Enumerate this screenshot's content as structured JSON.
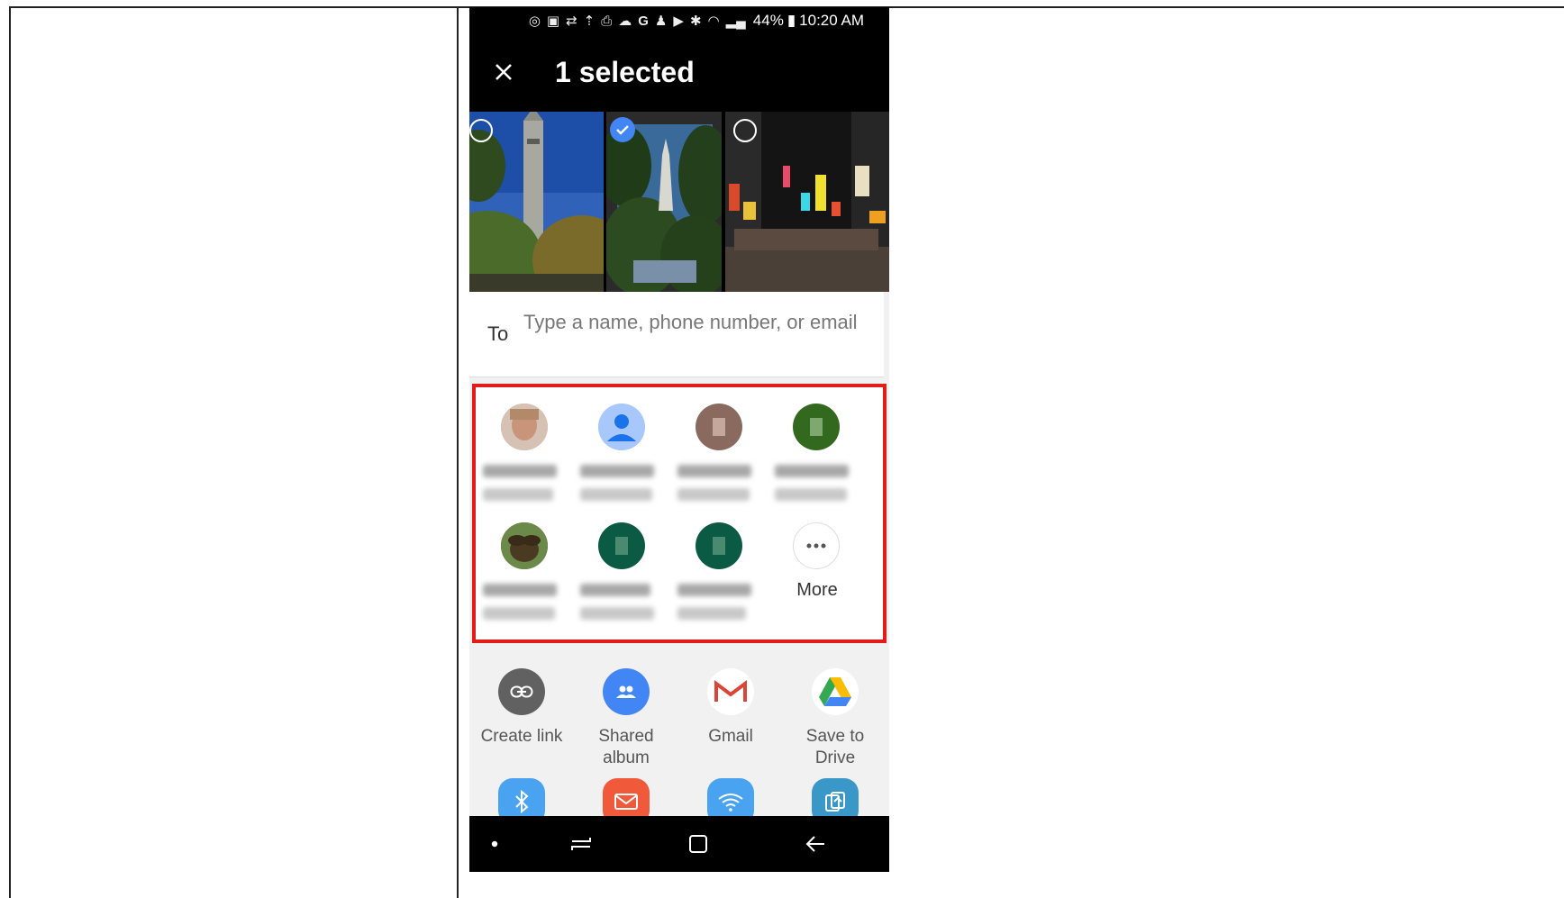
{
  "status_bar": {
    "battery": "44%",
    "time": "10:20 AM"
  },
  "app_bar": {
    "title": "1 selected",
    "close_icon": "close-icon"
  },
  "photos": [
    {
      "name": "tower-photo",
      "selected": false
    },
    {
      "name": "building-photo",
      "selected": true
    },
    {
      "name": "night-street-photo",
      "selected": false
    }
  ],
  "recipient": {
    "label": "To",
    "placeholder": "Type a name, phone number, or email"
  },
  "contacts": {
    "more_label": "More"
  },
  "share_apps": [
    {
      "label": "Create link",
      "icon": "link-icon",
      "color": "#616161"
    },
    {
      "label": "Shared album",
      "icon": "shared-album-icon",
      "color": "#4285f4"
    },
    {
      "label": "Gmail",
      "icon": "gmail-icon",
      "color": "#ffffff"
    },
    {
      "label": "Save to Drive",
      "icon": "drive-icon",
      "color": "#ffffff"
    }
  ],
  "colors": {
    "highlight_border": "#e41b1b",
    "check_blue": "#4285f4"
  }
}
